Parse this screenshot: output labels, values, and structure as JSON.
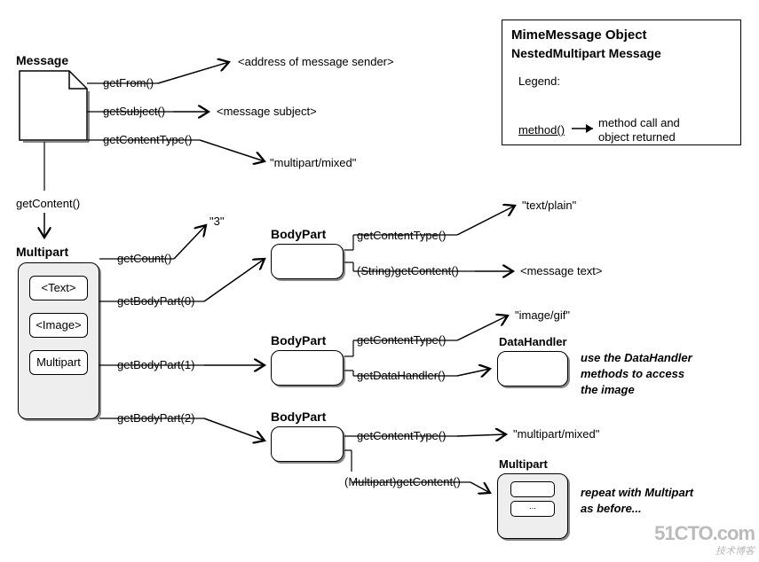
{
  "legend": {
    "title": "MimeMessage Object",
    "subtitle": "NestedMultipart Message",
    "legend_label": "Legend:",
    "method_label": "method()",
    "method_desc1": "method call and",
    "method_desc2": "object returned"
  },
  "message": {
    "label": "Message",
    "getFrom": "getFrom()",
    "getFrom_result": "<address of message sender>",
    "getSubject": "getSubject()",
    "getSubject_result": "<message subject>",
    "getContentType": "getContentType()",
    "getContentType_result": "\"multipart/mixed\"",
    "getContent": "getContent()"
  },
  "multipart": {
    "label": "Multipart",
    "items": {
      "text": "<Text>",
      "image": "<Image>",
      "multipart": "Multipart"
    },
    "getCount": "getCount()",
    "getCount_result": "\"3\"",
    "getBodyPart0": "getBodyPart(0)",
    "getBodyPart1": "getBodyPart(1)",
    "getBodyPart2": "getBodyPart(2)"
  },
  "bodypart0": {
    "label": "BodyPart",
    "getContentType": "getContentType()",
    "getContentType_result": "\"text/plain\"",
    "getContent": "(String)getContent()",
    "getContent_result": "<message text>"
  },
  "bodypart1": {
    "label": "BodyPart",
    "getContentType": "getContentType()",
    "getContentType_result": "\"image/gif\"",
    "getDataHandler": "getDataHandler()",
    "dataHandlerLabel": "DataHandler",
    "note1": "use the DataHandler",
    "note2": "methods to access",
    "note3": "the image"
  },
  "bodypart2": {
    "label": "BodyPart",
    "getContentType": "getContentType()",
    "getContentType_result": "\"multipart/mixed\"",
    "getContent": "(Multipart)getContent()",
    "multipartLabel": "Multipart",
    "note1": "repeat with Multipart",
    "note2": "as before..."
  },
  "watermark": {
    "line1": "51CTO.com",
    "line2": "技术博客"
  }
}
